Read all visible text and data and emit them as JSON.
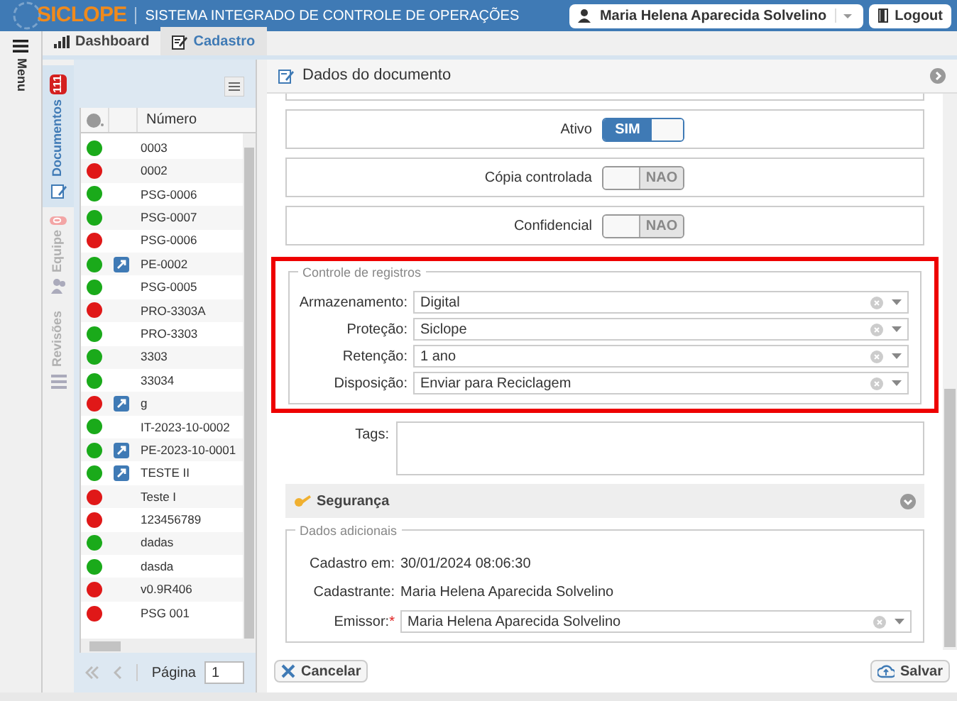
{
  "header": {
    "logo": "SICLOPE",
    "subtitle": "SISTEMA INTEGRADO DE CONTROLE DE OPERAÇÕES",
    "user": "Maria Helena Aparecida Solvelino",
    "logout": "Logout"
  },
  "menu": {
    "label": "Menu"
  },
  "tabs": [
    {
      "label": "Dashboard",
      "selected": false
    },
    {
      "label": "Cadastro",
      "selected": true
    }
  ],
  "side_tabs": [
    {
      "label": "Documentos",
      "badge": "111",
      "selected": true,
      "disabled": false
    },
    {
      "label": "Equipe",
      "badge": "0",
      "selected": false,
      "disabled": true
    },
    {
      "label": "Revisões",
      "selected": false,
      "disabled": true
    }
  ],
  "list": {
    "columns": [
      "Número"
    ],
    "rows": [
      {
        "color": "#1aaa1a",
        "linked": false,
        "number": "0003"
      },
      {
        "color": "#e01818",
        "linked": false,
        "number": "0002"
      },
      {
        "color": "#1aaa1a",
        "linked": false,
        "number": "PSG-0006"
      },
      {
        "color": "#1aaa1a",
        "linked": false,
        "number": "PSG-0007"
      },
      {
        "color": "#e01818",
        "linked": false,
        "number": "PSG-0006"
      },
      {
        "color": "#1aaa1a",
        "linked": true,
        "number": "PE-0002"
      },
      {
        "color": "#1aaa1a",
        "linked": false,
        "number": "PSG-0005"
      },
      {
        "color": "#e01818",
        "linked": false,
        "number": "PRO-3303A"
      },
      {
        "color": "#1aaa1a",
        "linked": false,
        "number": "PRO-3303"
      },
      {
        "color": "#1aaa1a",
        "linked": false,
        "number": "3303"
      },
      {
        "color": "#1aaa1a",
        "linked": false,
        "number": "33034"
      },
      {
        "color": "#e01818",
        "linked": true,
        "number": "g"
      },
      {
        "color": "#1aaa1a",
        "linked": false,
        "number": "IT-2023-10-0002"
      },
      {
        "color": "#1aaa1a",
        "linked": true,
        "number": "PE-2023-10-0001"
      },
      {
        "color": "#1aaa1a",
        "linked": true,
        "number": "TESTE II"
      },
      {
        "color": "#e01818",
        "linked": false,
        "number": "Teste I"
      },
      {
        "color": "#e01818",
        "linked": false,
        "number": "123456789"
      },
      {
        "color": "#1aaa1a",
        "linked": false,
        "number": "dadas"
      },
      {
        "color": "#1aaa1a",
        "linked": false,
        "number": "dasda"
      },
      {
        "color": "#e01818",
        "linked": false,
        "number": "v0.9R406"
      },
      {
        "color": "#e01818",
        "linked": false,
        "number": "PSG 001"
      }
    ],
    "pager": {
      "label": "Página",
      "page": "1"
    }
  },
  "panel": {
    "title": "Dados do documento",
    "toggles": [
      {
        "label": "Ativo",
        "on": true,
        "text": "SIM"
      },
      {
        "label": "Cópia controlada",
        "on": false,
        "text": "NAO"
      },
      {
        "label": "Confidencial",
        "on": false,
        "text": "NAO"
      }
    ],
    "records": {
      "legend": "Controle de registros",
      "highlighted": true,
      "fields": [
        {
          "label": "Armazenamento:",
          "value": "Digital"
        },
        {
          "label": "Proteção:",
          "value": "Siclope"
        },
        {
          "label": "Retenção:",
          "value": "1 ano"
        },
        {
          "label": "Disposição:",
          "value": "Enviar para Reciclagem"
        }
      ]
    },
    "tags": {
      "label": "Tags:"
    },
    "security": {
      "title": "Segurança",
      "expanded": false
    },
    "extra": {
      "legend": "Dados adicionais",
      "items": [
        {
          "label": "Cadastro em:",
          "value": "30/01/2024 08:06:30"
        },
        {
          "label": "Cadastrante:",
          "value": "Maria Helena Aparecida Solvelino"
        }
      ],
      "issuer": {
        "label": "Emissor:",
        "required_mark": "*",
        "value": "Maria Helena Aparecida Solvelino"
      }
    },
    "buttons": [
      {
        "kind": "cancel",
        "label": "Cancelar"
      },
      {
        "kind": "save",
        "label": "Salvar"
      }
    ]
  }
}
